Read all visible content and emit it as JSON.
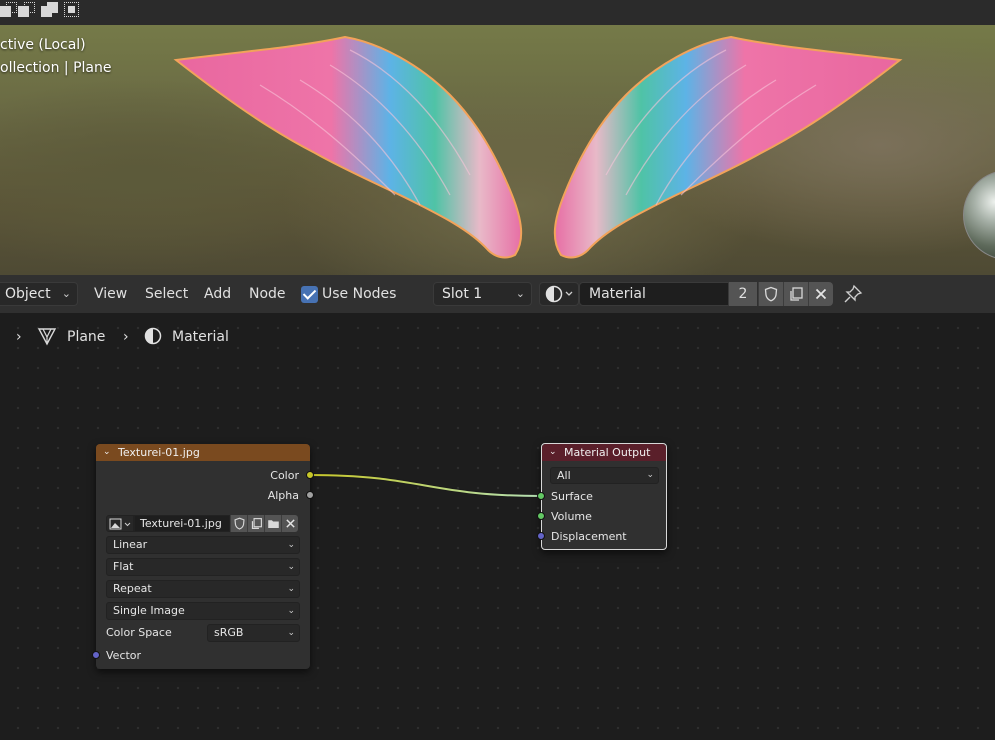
{
  "viewport": {
    "overlay_line1": "ctive (Local)",
    "overlay_line2": "ollection | Plane"
  },
  "header": {
    "mode_dropdown": "Object",
    "menus": [
      "View",
      "Select",
      "Add",
      "Node"
    ],
    "use_nodes_label": "Use Nodes",
    "use_nodes_checked": true,
    "slot_dropdown": "Slot 1",
    "material_name": "Material",
    "material_users": "2"
  },
  "breadcrumb": {
    "object": "Plane",
    "material": "Material"
  },
  "image_texture_node": {
    "title": "Texturei-01.jpg",
    "outputs": [
      "Color",
      "Alpha"
    ],
    "image_name": "Texturei-01.jpg",
    "interpolation": "Linear",
    "projection": "Flat",
    "extension": "Repeat",
    "source": "Single Image",
    "color_space_label": "Color Space",
    "color_space": "sRGB",
    "input": "Vector",
    "header_color": "#7a4a1f"
  },
  "material_output_node": {
    "title": "Material Output",
    "target": "All",
    "inputs": [
      "Surface",
      "Volume",
      "Displacement"
    ],
    "header_color": "#5a1f2a"
  },
  "colors": {
    "color_socket": "#c7c729",
    "alpha_socket": "#a1a1a1",
    "shader_socket": "#63c763",
    "vector_socket": "#6363c7",
    "accent": "#4772b3"
  }
}
